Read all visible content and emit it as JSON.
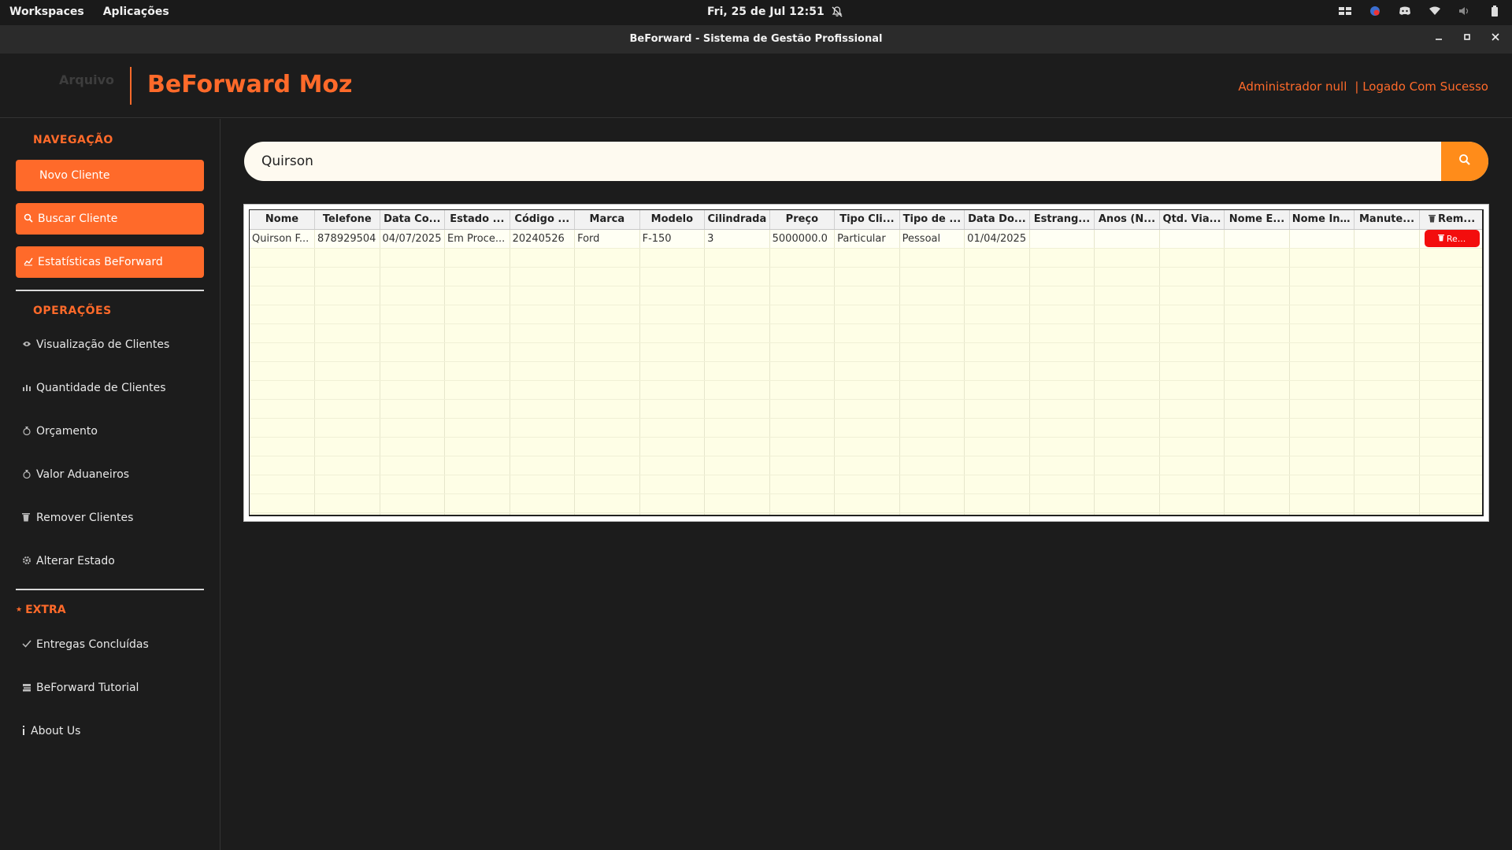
{
  "system_bar": {
    "workspaces": "Workspaces",
    "applications": "Aplicações",
    "clock": "Fri, 25 de Jul  12:51"
  },
  "window": {
    "title": "BeForward - Sistema de Gestão Profissional"
  },
  "header": {
    "menu_arquivo": "Arquivo",
    "brand": "BeForward Moz",
    "user": "Administrador null",
    "status": "| Logado Com Sucesso"
  },
  "sidebar": {
    "nav_title": "NAVEGAÇÃO",
    "nav_items": [
      {
        "label": "Novo Cliente",
        "icon": ""
      },
      {
        "label": "Buscar Cliente",
        "icon": "search-icon"
      },
      {
        "label": "Estatísticas BeForward",
        "icon": "chart-icon"
      }
    ],
    "ops_title": "OPERAÇÕES",
    "ops_items": [
      {
        "label": "Visualização de Clientes",
        "icon": "eye-icon"
      },
      {
        "label": "Quantidade de Clientes",
        "icon": "bar-chart-icon"
      },
      {
        "label": "Orçamento",
        "icon": "money-bag-icon"
      },
      {
        "label": "Valor Aduaneiros",
        "icon": "money-bag-icon"
      },
      {
        "label": "Remover Clientes",
        "icon": "trash-icon"
      },
      {
        "label": "Alterar Estado",
        "icon": "gear-icon"
      }
    ],
    "extra_title": "EXTRA",
    "extra_items": [
      {
        "label": "Entregas Concluídas",
        "icon": "check-icon"
      },
      {
        "label": "BeForward Tutorial",
        "icon": "book-icon"
      },
      {
        "label": "About Us",
        "icon": "info-icon"
      }
    ]
  },
  "search": {
    "value": "Quirson"
  },
  "table": {
    "headers": [
      "Nome",
      "Telefone",
      "Data Co...",
      "Estado ...",
      "Código ...",
      "Marca",
      "Modelo",
      "Cilindrada",
      "Preço",
      "Tipo Cli...",
      "Tipo de ...",
      "Data Do...",
      "Estrang...",
      "Anos (N...",
      "Qtd. Via...",
      "Nome E...",
      "Nome In...",
      "Manute...",
      "Rem..."
    ],
    "rows": [
      [
        "Quirson F...",
        "878929504",
        "04/07/2025",
        "Em Proce...",
        "20240526",
        "Ford",
        "F-150",
        "3",
        "5000000.0",
        "Particular",
        "Pessoal",
        "01/04/2025",
        "",
        "",
        "",
        "",
        "",
        ""
      ]
    ],
    "remove_button_label": "Re...",
    "empty_rows": 15
  },
  "colors": {
    "accent": "#ff6a2a",
    "search_button": "#ff8c1a",
    "remove_button": "#f30d0d",
    "table_background": "#fefee6"
  }
}
